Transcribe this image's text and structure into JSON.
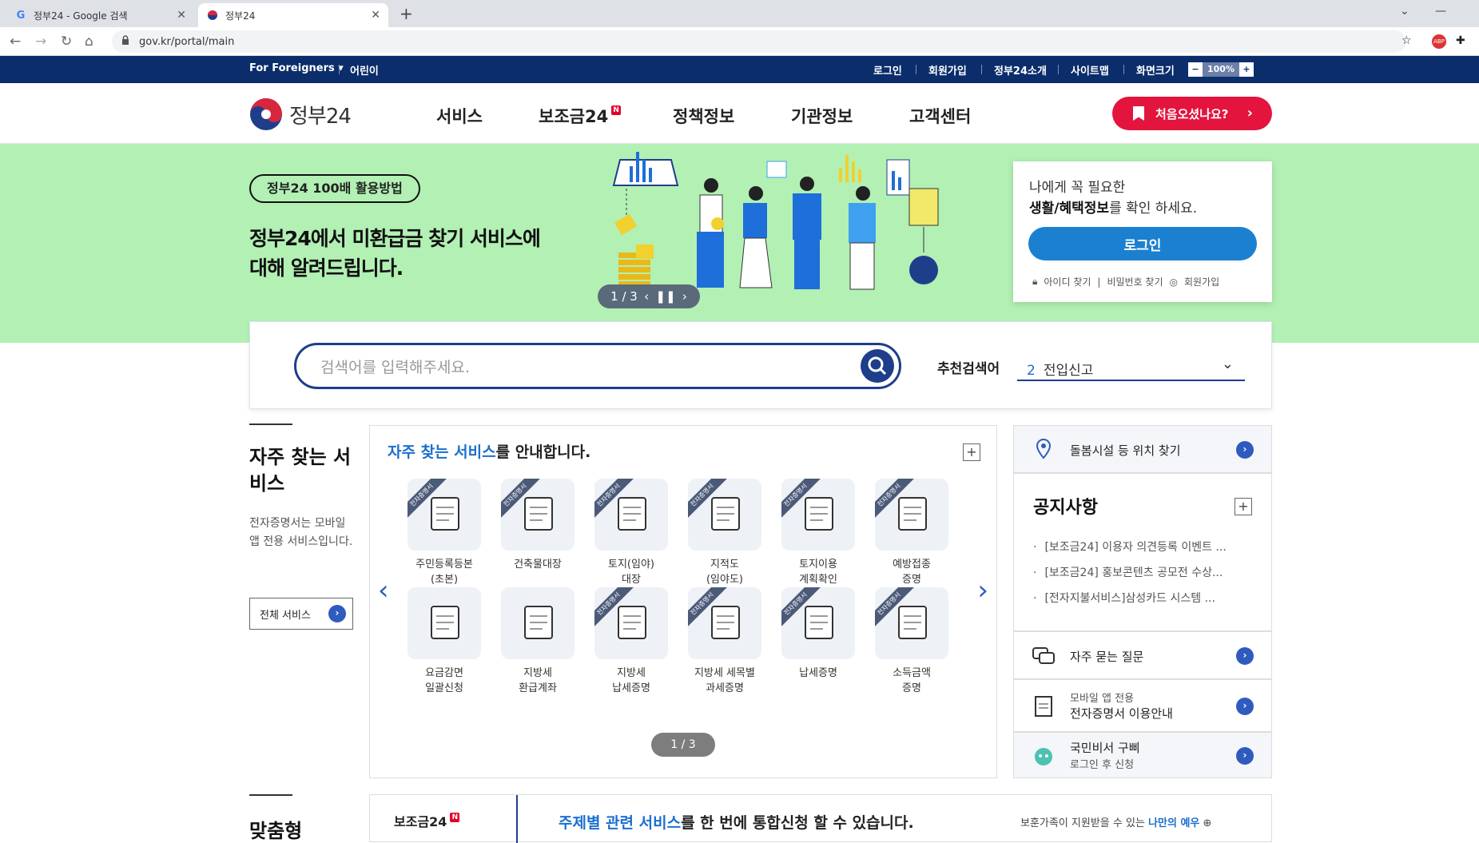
{
  "browser": {
    "tabs": [
      {
        "title": "정부24 - Google 검색",
        "favicon": "G"
      },
      {
        "title": "정부24",
        "favicon": "●"
      }
    ],
    "url": "gov.kr/portal/main"
  },
  "gnb": {
    "foreigners": "For Foreigners",
    "kids": "어린이",
    "links": [
      "로그인",
      "회원가입",
      "정부24소개",
      "사이트맵",
      "화면크기"
    ],
    "zoom": "100%"
  },
  "header": {
    "logo_text": "정부24",
    "nav": [
      "서비스",
      "보조금24",
      "정책정보",
      "기관정보",
      "고객센터"
    ],
    "new_badge": "N",
    "first_visit": "처음오셨나요?"
  },
  "hero": {
    "pill": "정부24 100배 활용방법",
    "title_line1": "정부24에서 미환급금 찾기 서비스에",
    "title_line2": "대해 알려드립니다.",
    "pager": "1 / 3"
  },
  "login_box": {
    "line1": "나에게 꼭 필요한",
    "line2_bold": "생활/혜택정보",
    "line2_rest": "를 확인 하세요.",
    "button": "로그인",
    "links": [
      "아이디 찾기",
      "비밀번호 찾기",
      "회원가입"
    ]
  },
  "search": {
    "placeholder": "검색어를 입력해주세요.",
    "rec_label": "추천검색어",
    "rec_num": "2",
    "rec_value": "전입신고"
  },
  "frequent": {
    "title": "자주 찾는 서비스",
    "desc": "전자증명서는 모바일 앱 전용 서비스입니다.",
    "all_button": "전체 서비스",
    "panel_title_em": "자주 찾는 서비스",
    "panel_title_rest": "를 안내합니다.",
    "ribbon": "전자증명서",
    "pager": "1 / 3",
    "services": [
      {
        "line1": "주민등록등본",
        "line2": "(초본)",
        "ribbon": true
      },
      {
        "line1": "건축물대장",
        "line2": "",
        "ribbon": true
      },
      {
        "line1": "토지(임야)",
        "line2": "대장",
        "ribbon": true
      },
      {
        "line1": "지적도",
        "line2": "(임야도)",
        "ribbon": true
      },
      {
        "line1": "토지이용",
        "line2": "계획확인",
        "ribbon": true
      },
      {
        "line1": "예방접종",
        "line2": "증명",
        "ribbon": true
      },
      {
        "line1": "요금감면",
        "line2": "일괄신청",
        "ribbon": false
      },
      {
        "line1": "지방세",
        "line2": "환급계좌",
        "ribbon": false
      },
      {
        "line1": "지방세",
        "line2": "납세증명",
        "ribbon": true
      },
      {
        "line1": "지방세 세목별",
        "line2": "과세증명",
        "ribbon": true
      },
      {
        "line1": "납세증명",
        "line2": "",
        "ribbon": true
      },
      {
        "line1": "소득금액",
        "line2": "증명",
        "ribbon": true
      }
    ]
  },
  "right": {
    "care": "돌봄시설 등 위치 찾기",
    "notice_title": "공지사항",
    "notices": [
      "[보조금24] 이용자 의견등록 이벤트 ...",
      "[보조금24] 홍보콘텐츠 공모전 수상...",
      "[전자지불서비스]삼성카드 시스템 ..."
    ],
    "faq": "자주 묻는 질문",
    "mobile_line1": "모바일 앱 전용",
    "mobile_line2": "전자증명서 이용안내",
    "secretary_line1": "국민비서 구삐",
    "secretary_line2": "로그인 후 신청"
  },
  "bottom": {
    "side_title": "맞춤형",
    "tab": "보조금24",
    "text_em": "주제별 관련 서비스",
    "text_rest": "를 한 번에 통합신청 할 수 있습니다.",
    "right_text": "보훈가족이 지원받을 수 있는 ",
    "right_bold": "나만의 예우"
  }
}
